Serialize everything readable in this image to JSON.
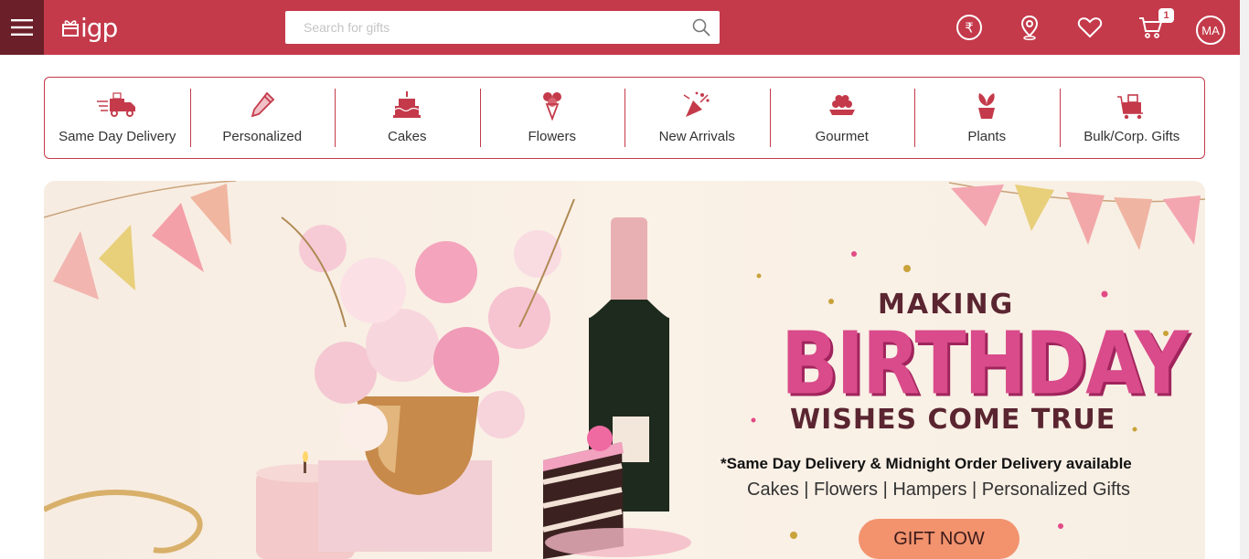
{
  "header": {
    "logo_text": "igp",
    "search_placeholder": "Search for gifts",
    "cart_count": "1",
    "avatar_initials": "MA"
  },
  "categories": [
    {
      "label": "Same Day Delivery",
      "icon": "delivery-truck-icon"
    },
    {
      "label": "Personalized",
      "icon": "pencil-icon"
    },
    {
      "label": "Cakes",
      "icon": "cake-icon"
    },
    {
      "label": "Flowers",
      "icon": "bouquet-icon"
    },
    {
      "label": "New Arrivals",
      "icon": "party-popper-icon"
    },
    {
      "label": "Gourmet",
      "icon": "gourmet-icon"
    },
    {
      "label": "Plants",
      "icon": "plant-icon"
    },
    {
      "label": "Bulk/Corp. Gifts",
      "icon": "corporate-gift-icon"
    }
  ],
  "banner": {
    "line1": "MAKING",
    "line2": "BIRTHDAY",
    "line3": "WISHES COME TRUE",
    "delivery_note": "*Same Day Delivery & Midnight Order Delivery available",
    "categories_text": "Cakes | Flowers | Hampers | Personalized Gifts",
    "cta": "GIFT NOW"
  },
  "colors": {
    "brand": "#c43a4a",
    "menu_bg": "#6b1f28",
    "cta": "#f2936e",
    "birthday_pink": "#d94b8a"
  }
}
